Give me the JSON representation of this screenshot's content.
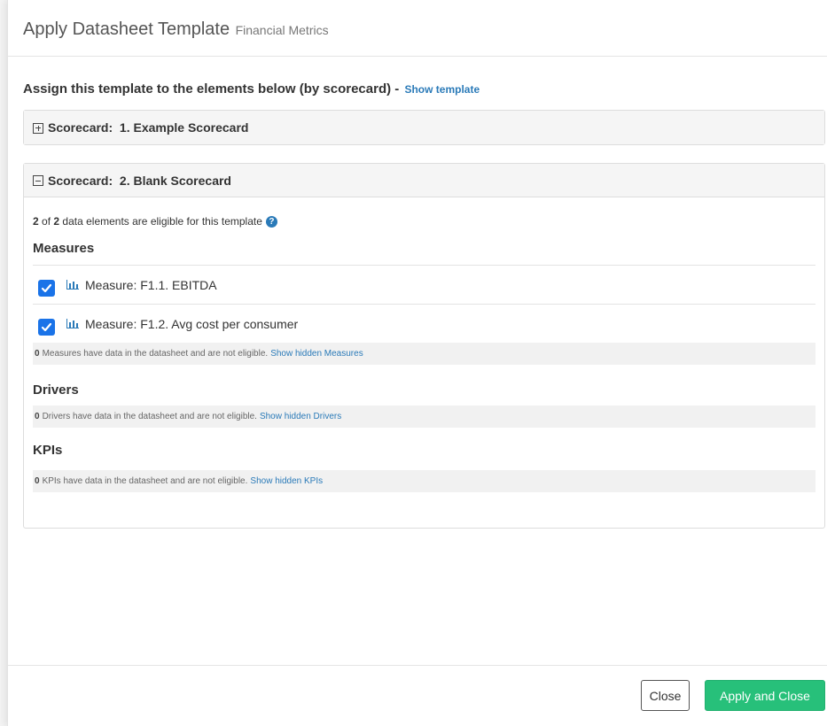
{
  "modal": {
    "title": "Apply Datasheet Template",
    "subtitle": "Financial Metrics"
  },
  "assign": {
    "text": "Assign this template to the elements below (by scorecard) -",
    "show_template_link": "Show template"
  },
  "scorecards": [
    {
      "label": "Scorecard:  1. Example Scorecard",
      "expanded": false
    },
    {
      "label": "Scorecard:  2. Blank Scorecard",
      "expanded": true
    }
  ],
  "eligible": {
    "count": "2",
    "of": "of",
    "total": "2",
    "text": "data elements are eligible for this template"
  },
  "measures": {
    "title": "Measures",
    "items": [
      {
        "label": "Measure: F1.1. EBITDA",
        "checked": true
      },
      {
        "label": "Measure: F1.2. Avg cost per consumer",
        "checked": true
      }
    ],
    "notice_count": "0",
    "notice_text": "Measures have data in the datasheet and are not eligible.",
    "notice_link": "Show hidden Measures"
  },
  "drivers": {
    "title": "Drivers",
    "notice_count": "0",
    "notice_text": "Drivers have data in the datasheet and are not eligible.",
    "notice_link": "Show hidden Drivers"
  },
  "kpis": {
    "title": "KPIs",
    "notice_count": "0",
    "notice_text": "KPIs have data in the datasheet and are not eligible.",
    "notice_link": "Show hidden KPIs"
  },
  "footer": {
    "close_label": "Close",
    "apply_label": "Apply and Close"
  },
  "colors": {
    "link": "#2a7ab8",
    "checkbox": "#1a73e8",
    "apply_button": "#27c07a"
  },
  "icons": {
    "expand": "plus-square-icon",
    "collapse": "minus-square-icon",
    "help": "question-circle-icon",
    "measure": "bar-chart-icon",
    "check": "checkmark-icon"
  }
}
